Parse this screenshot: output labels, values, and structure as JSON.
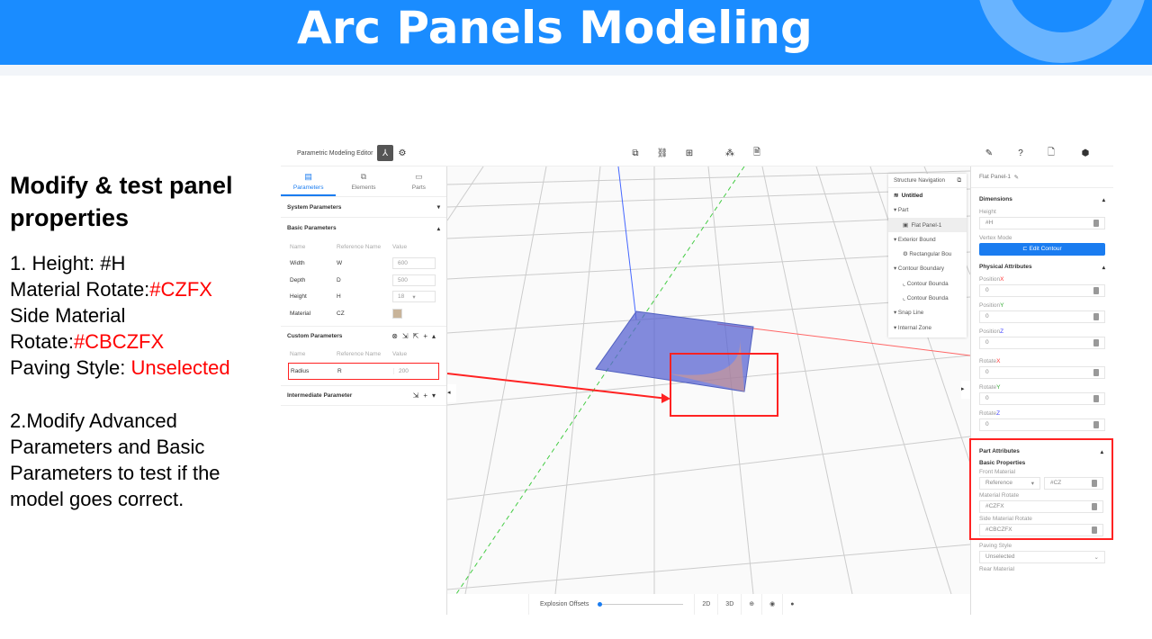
{
  "slide": {
    "title": "Arc Panels Modeling",
    "heading": "Modify & test panel properties",
    "step1_prefix": "1. Height: #H",
    "mr_label": "Material Rotate:",
    "mr_value": "#CZFX",
    "smr_label": "Side Material Rotate:",
    "smr_value": "#CBCZFX",
    "ps_label": "Paving Style: ",
    "ps_value": "Unselected",
    "step2": "2.Modify Advanced Parameters and Basic Parameters to test if the model goes correct."
  },
  "app": {
    "title": "Parametric Modeling Editor",
    "tabs": [
      "Parameters",
      "Elements",
      "Parts"
    ],
    "system_params": "System Parameters",
    "basic_params": "Basic Parameters",
    "cols": [
      "Name",
      "Reference Name",
      "Value"
    ],
    "basic_rows": [
      {
        "name": "Width",
        "ref": "W",
        "value": "600"
      },
      {
        "name": "Depth",
        "ref": "D",
        "value": "500"
      },
      {
        "name": "Height",
        "ref": "H",
        "value": "18"
      },
      {
        "name": "Material",
        "ref": "CZ"
      }
    ],
    "custom_params": "Custom Parameters",
    "custom_rows": [
      {
        "name": "Radius",
        "ref": "R",
        "value": "200"
      }
    ],
    "intermediate": "Intermediate Parameter",
    "nav": {
      "title": "Structure Navigation",
      "items": [
        "Untitled",
        "Part",
        "Flat Panel-1",
        "Exterior Bound",
        "Rectangular Bou",
        "Contour Boundary",
        "Contour Bounda",
        "Contour Bounda",
        "Snap Line",
        "Internal Zone"
      ]
    },
    "bottom": {
      "explosion": "Explosion Offsets",
      "b2d": "2D",
      "b3d": "3D",
      "explosion_value": 0
    },
    "right": {
      "name": "Flat Panel-1",
      "dimensions": "Dimensions",
      "height_label": "Height",
      "height_value": "#H",
      "vertex_mode": "Vertex Mode",
      "edit_contour": "Edit Contour",
      "physical": "Physical Attributes",
      "fields": [
        {
          "label": "Position",
          "axis": "X",
          "value": "0"
        },
        {
          "label": "Position",
          "axis": "Y",
          "value": "0"
        },
        {
          "label": "Position",
          "axis": "Z",
          "value": "0"
        },
        {
          "label": "Rotate",
          "axis": "X",
          "value": "0"
        },
        {
          "label": "Rotate",
          "axis": "Y",
          "value": "0"
        },
        {
          "label": "Rotate",
          "axis": "Z",
          "value": "0"
        }
      ],
      "part_attr": "Part Attributes",
      "basic_props": "Basic Properties",
      "front_material": "Front Material",
      "front_sel": "Reference",
      "front_val": "#CZ",
      "mat_rot": "Material Rotate",
      "mat_rot_val": "#CZFX",
      "side_rot": "Side Material Rotate",
      "side_rot_val": "#CBCZFX",
      "paving": "Paving Style",
      "paving_val": "Unselected",
      "rear": "Rear Material"
    }
  },
  "colors": {
    "accent": "#1a7cf0",
    "highlight": "#ff2020",
    "banner": "#1a8cff"
  }
}
